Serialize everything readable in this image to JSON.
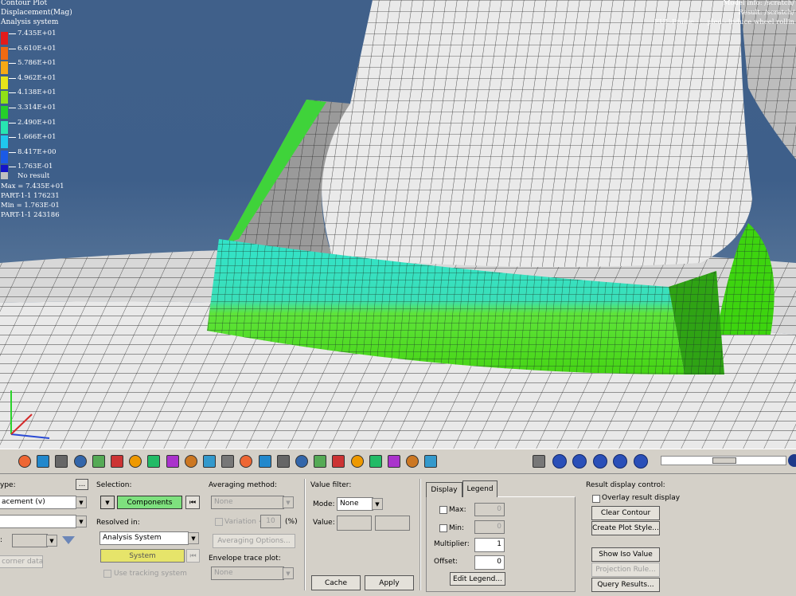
{
  "legend": {
    "title_lines": [
      "Contour Plot",
      "Displacement(Mag)",
      "Analysis system"
    ],
    "bands": [
      {
        "label": "7.435E+01",
        "color": "#e21b1b"
      },
      {
        "label": "6.610E+01",
        "color": "#ef6a12"
      },
      {
        "label": "5.786E+01",
        "color": "#f5a916"
      },
      {
        "label": "4.962E+01",
        "color": "#e6e419"
      },
      {
        "label": "4.138E+01",
        "color": "#90e017"
      },
      {
        "label": "3.314E+01",
        "color": "#25cf2a"
      },
      {
        "label": "2.490E+01",
        "color": "#27e6b1"
      },
      {
        "label": "1.666E+01",
        "color": "#1fc8ee"
      },
      {
        "label": "8.417E+00",
        "color": "#1b5ae6"
      },
      {
        "label": "1.763E-01",
        "color": "#1414c8"
      }
    ],
    "no_result_label": "No result",
    "no_result_color": "#c0c0c0",
    "stats": [
      "Max = 7.435E+01",
      "PART-1-1 176231",
      "Min = 1.763E-01",
      "PART-1-1 243186"
    ]
  },
  "model_info": [
    "Model info: /scratch/",
    "Result: /scratch/",
    "EUL-Frame : ...pled - induce wheel rollin"
  ],
  "colors": {
    "toolbar_bg": "#d4d0c8",
    "accent_green": "#7ee07e",
    "accent_yellow": "#e6e46a"
  },
  "toolbar_icons": [
    "contour-icon",
    "legend-cube-icon",
    "cube-icon",
    "components-icon",
    "flip-icon",
    "isolate-icon",
    "bars-icon",
    "vector-icon",
    "deformed-icon",
    "sphere-icon",
    "tensor-icon",
    "marker-icon",
    "histogram-icon",
    "curve-icon",
    "scissor-icon",
    "notes-icon",
    "measure-icon",
    "axis-icon",
    "query-icon",
    "bubble-icon",
    "pen-icon",
    "print-icon",
    "plot-icon",
    "playback-icon",
    "first-frame-icon",
    "rewind-icon",
    "play-icon",
    "fast-forward-icon",
    "last-frame-icon"
  ],
  "panel": {
    "type_label": "ype:",
    "type_more": "...",
    "type_value": "acement (v)",
    "type_sub_value": "",
    "layer_label": ":",
    "corner_data_label": "e corner data",
    "selection_label": "Selection:",
    "components_button": "Components",
    "resolved_label": "Resolved in:",
    "resolved_value": "Analysis System",
    "system_button": "System",
    "tracking_label": "Use tracking system",
    "averaging_label": "Averaging method:",
    "averaging_value": "None",
    "variation_label": "Variation <",
    "variation_value": "10",
    "variation_unit": "(%)",
    "averaging_options": "Averaging Options...",
    "envelope_label": "Envelope trace plot:",
    "envelope_value": "None",
    "value_filter_label": "Value filter:",
    "mode_label": "Mode:",
    "mode_value": "None",
    "value_label": "Value:",
    "cache_button": "Cache",
    "apply_button": "Apply",
    "tab_display": "Display",
    "tab_legend": "Legend",
    "max_label": "Max:",
    "max_value": "0",
    "min_label": "Min:",
    "min_value": "0",
    "multiplier_label": "Multiplier:",
    "multiplier_value": "1",
    "offset_label": "Offset:",
    "offset_value": "0",
    "edit_legend_button": "Edit Legend...",
    "rdc_label": "Result display control:",
    "overlay_label": "Overlay result display",
    "clear_contour": "Clear Contour",
    "create_plot_style": "Create Plot Style...",
    "show_iso": "Show Iso Value",
    "projection_rule": "Projection Rule...",
    "query_results": "Query Results..."
  }
}
